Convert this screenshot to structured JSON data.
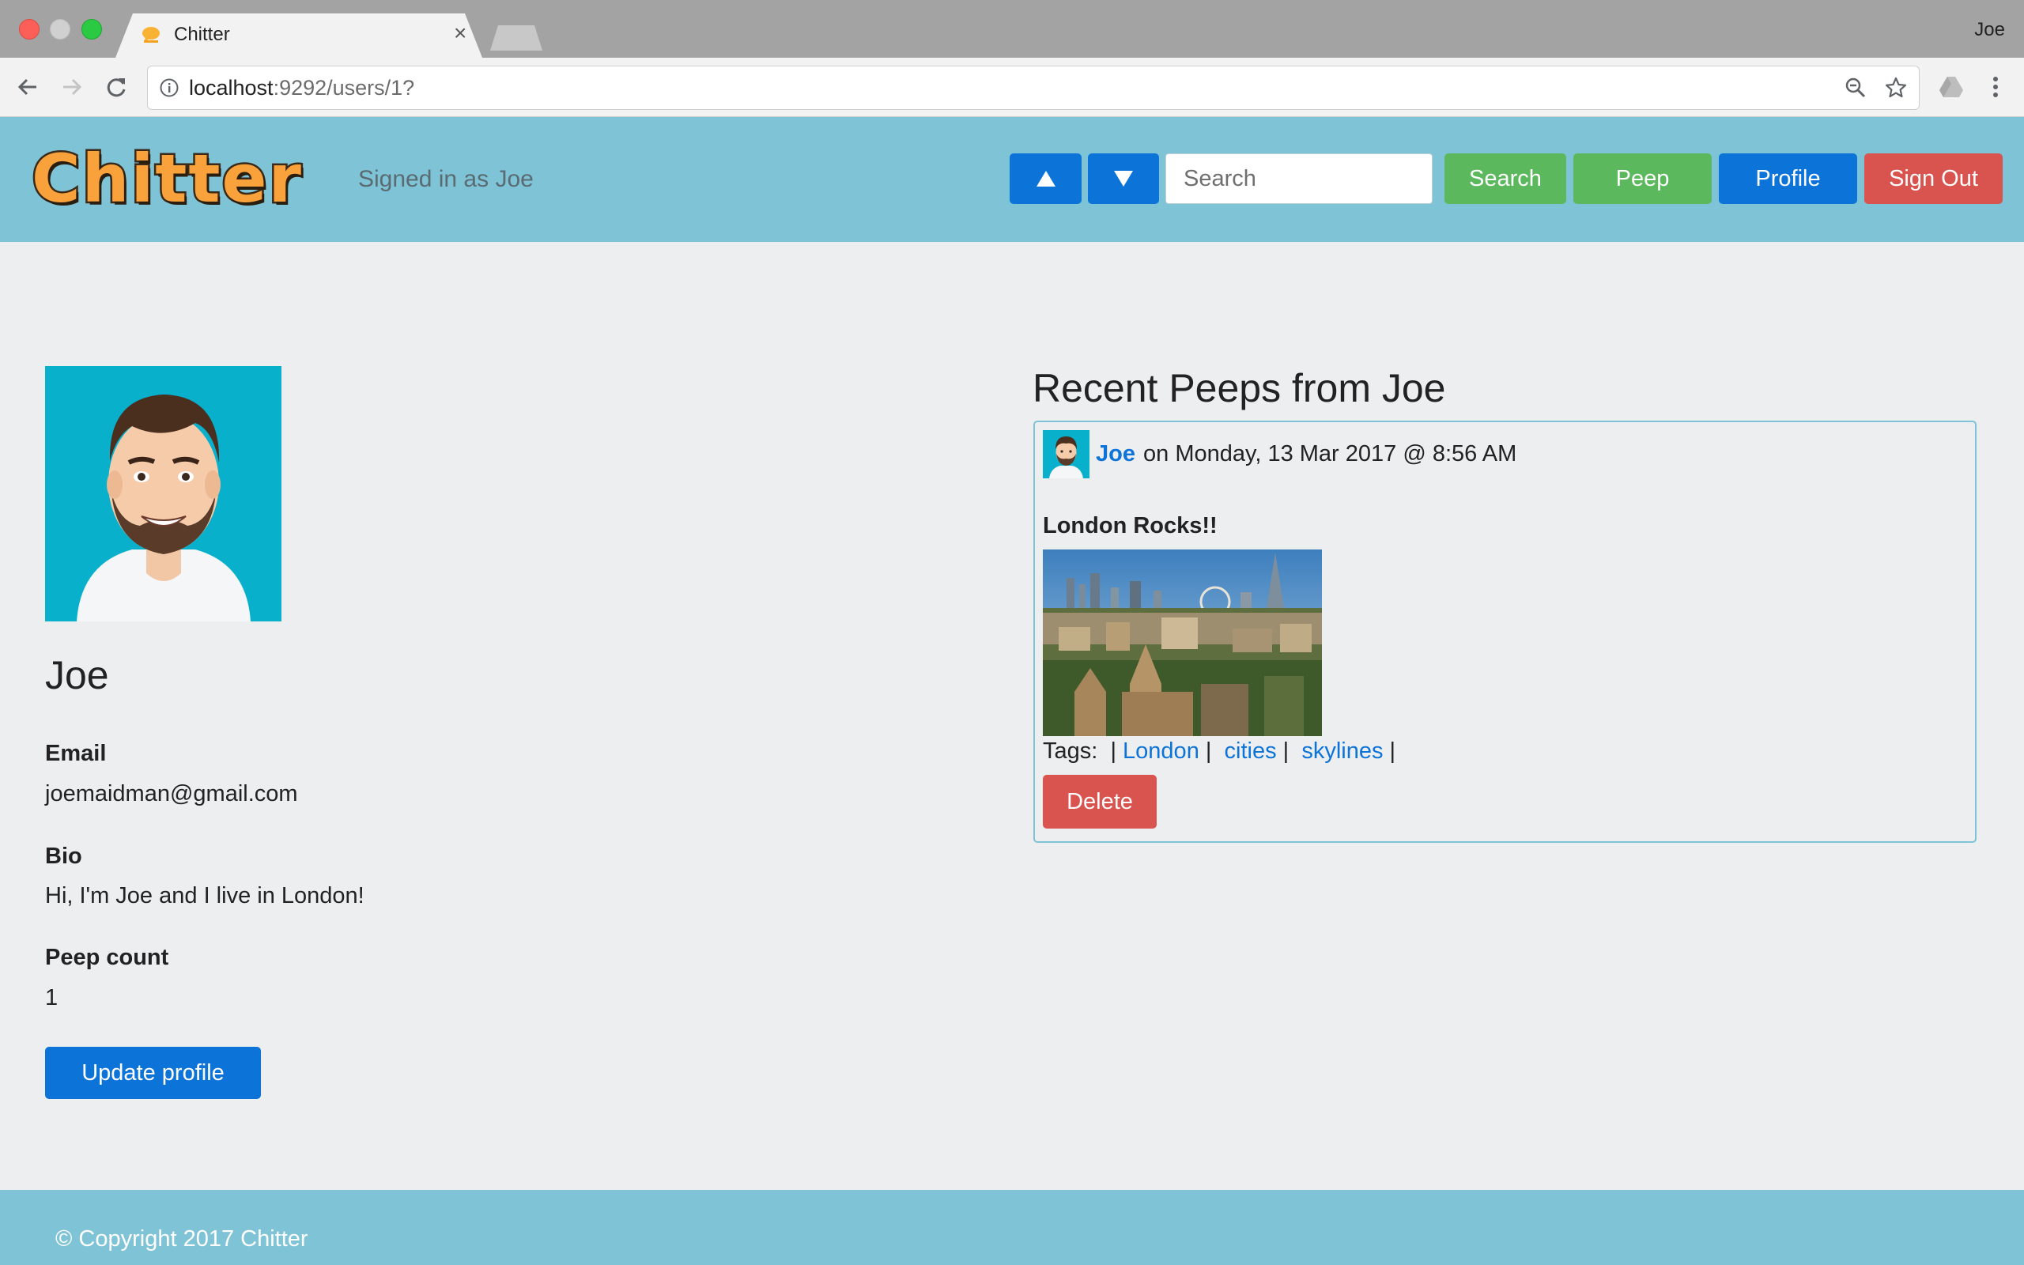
{
  "browser": {
    "tab_title": "Chitter",
    "tab_close": "×",
    "profile_name": "Joe",
    "url_host": "localhost",
    "url_path": ":9292/users/1?"
  },
  "header": {
    "logo_text": "Chitter",
    "signed_in_text": "Signed in as Joe",
    "search_placeholder": "Search",
    "search_label": "Search",
    "peep_label": "Peep",
    "profile_label": "Profile",
    "signout_label": "Sign Out"
  },
  "profile": {
    "name": "Joe",
    "email_label": "Email",
    "email": "joemaidman@gmail.com",
    "bio_label": "Bio",
    "bio": "Hi, I'm Joe and I live in London!",
    "peep_count_label": "Peep count",
    "peep_count": "1",
    "update_label": "Update profile"
  },
  "peeps": {
    "title": "Recent Peeps from Joe",
    "items": [
      {
        "author": "Joe",
        "date_text": "on Monday, 13 Mar 2017 @ 8:56 AM",
        "text": "London Rocks!!",
        "tags_label": "Tags:",
        "tags": [
          "London",
          "cities",
          "skylines"
        ],
        "delete_label": "Delete"
      }
    ]
  },
  "footer": {
    "copyright": "© Copyright 2017 Chitter"
  },
  "colors": {
    "header_bg": "#7FC3D6",
    "page_bg": "#ECEEF0",
    "primary": "#0C74D9",
    "success": "#5CB85C",
    "danger": "#D9534F",
    "logo": "#F9A13A"
  }
}
